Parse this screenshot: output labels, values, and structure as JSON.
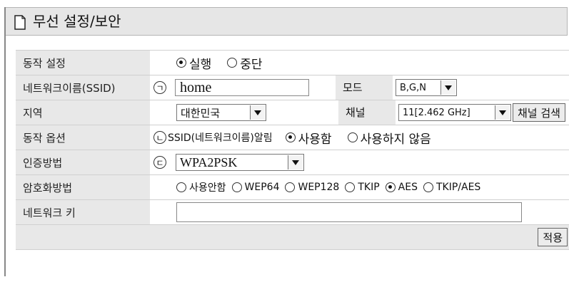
{
  "title": "무선 설정/보안",
  "rows": {
    "operation": {
      "label": "동작 설정",
      "options": [
        {
          "label": "실행",
          "selected": true
        },
        {
          "label": "중단",
          "selected": false
        }
      ]
    },
    "ssid": {
      "label": "네트워크이름(SSID)",
      "marker": "ㄱ",
      "value": "home",
      "mode_label": "모드",
      "mode_value": "B,G,N"
    },
    "region": {
      "label": "지역",
      "value": "대한민국",
      "channel_label": "채널",
      "channel_value": "11[2.462 GHz]",
      "scan_button": "채널 검색"
    },
    "options": {
      "label": "동작 옵션",
      "marker": "ㄴ",
      "text": "SSID(네트워크이름)알림",
      "choices": [
        {
          "label": "사용함",
          "selected": true
        },
        {
          "label": "사용하지 않음",
          "selected": false
        }
      ]
    },
    "auth": {
      "label": "인증방법",
      "marker": "ㄷ",
      "value": "WPA2PSK"
    },
    "encryption": {
      "label": "암호화방법",
      "choices": [
        {
          "label": "사용안함",
          "selected": false
        },
        {
          "label": "WEP64",
          "selected": false
        },
        {
          "label": "WEP128",
          "selected": false
        },
        {
          "label": "TKIP",
          "selected": false
        },
        {
          "label": "AES",
          "selected": true
        },
        {
          "label": "TKIP/AES",
          "selected": false
        }
      ]
    },
    "key": {
      "label": "네트워크 키",
      "value": ""
    }
  },
  "apply_button": "적용"
}
